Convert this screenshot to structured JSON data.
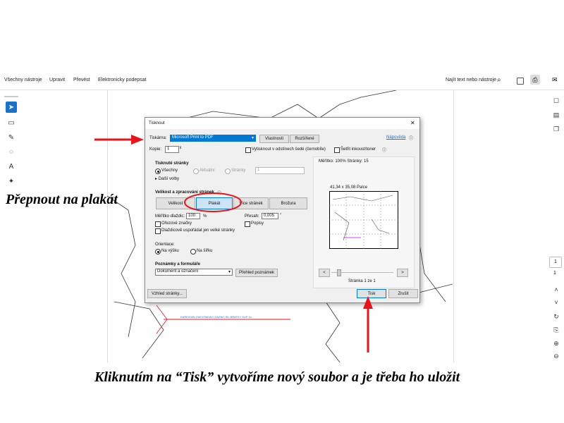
{
  "toolbar": {
    "menu": [
      "Všechny nástroje",
      "Upravit",
      "Převést",
      "Elektronicky podepsat"
    ],
    "search_text": "Najít text nebo nástroje"
  },
  "print_dialog": {
    "title": "Tisknout",
    "printer_label": "Tiskárna:",
    "printer_value": "Microsoft Print to PDF",
    "properties_button": "Vlastnosti",
    "advanced_button": "Rozšířené",
    "help_link": "Nápověda",
    "copies_label": "Kopie:",
    "copies_value": "1",
    "grayscale_label": "Vytisknout v odstínech šedé (černobíle)",
    "save_ink_label": "Šetřit inkoust/toner",
    "pages_section": {
      "title": "Tisknuté stránky",
      "all": "Všechny",
      "current": "Aktuální",
      "pages": "Stránky",
      "pages_value": "1",
      "more": "Další volby"
    },
    "sizing_section": {
      "title": "Velikost a zpracování stránek",
      "buttons": [
        "Velikost",
        "Plakát",
        "Více stránek",
        "Brožura"
      ],
      "tile_scale_label": "Měřítko dlaždic:",
      "tile_scale_value": "100",
      "percent": "%",
      "overlap_label": "Přesah:",
      "overlap_value": "0,005",
      "overlap_unit": "\"",
      "cut_marks": "Ořezové značky",
      "labels": "Popisy",
      "tile_large_only": "Dlaždicově uspořádat jen velké stránky"
    },
    "orientation_section": {
      "title": "Orientace:",
      "portrait": "Na výšku",
      "landscape": "Na šířku"
    },
    "comments_section": {
      "title": "Poznámky a formuláře",
      "value": "Dokument a označení",
      "summary_button": "Přehled poznámek"
    },
    "preview": {
      "scale_text": "Měřítko: 100% Stránky: 15",
      "size_text": "41,34 x 35,08 Palce",
      "page_info": "Stránka 1 ze 1"
    },
    "page_setup_button": "Vzhled stránky...",
    "print_button": "Tisk",
    "cancel_button": "Zrušit"
  },
  "right_panel": {
    "page_number": "1",
    "page_total": "1"
  },
  "pattern_text": "KAREIGAN ZAKVONDACI ZAZNO SIL BRATKY SUP 1x",
  "annotations": {
    "left_caption": "Přepnout na plakát",
    "bottom_caption": "Kliknutím na “Tisk” vytvoříme nový soubor a je třeba ho uložit"
  },
  "colors": {
    "accent": "#1a73c9",
    "highlight_red": "#e8141b",
    "arrow_red": "#e8141b"
  }
}
